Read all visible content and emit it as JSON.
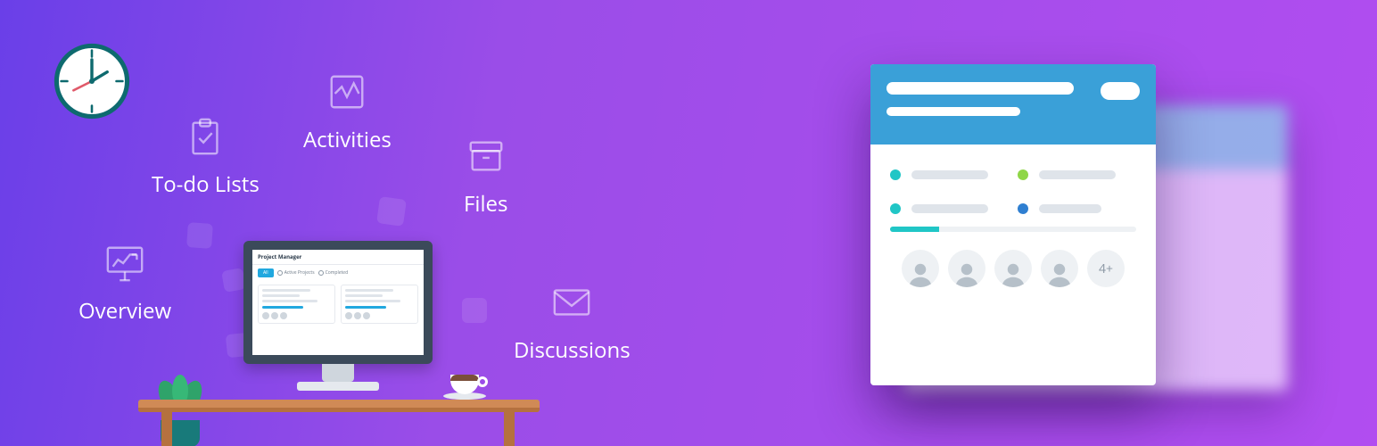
{
  "features": {
    "overview": {
      "label": "Overview"
    },
    "todo": {
      "label": "To-do Lists"
    },
    "activities": {
      "label": "Activities"
    },
    "files": {
      "label": "Files"
    },
    "discussions": {
      "label": "Discussions"
    }
  },
  "monitor_screen": {
    "app_title": "Project Manager",
    "primary_chip": "All",
    "tabs": {
      "active": "Active Projects",
      "completed": "Completed"
    }
  },
  "project_card": {
    "avatars_more_label": "4+",
    "progress_percent": 20,
    "dot_colors": {
      "a": "#20c6c6",
      "b": "#8fd647",
      "c": "#20c6c6",
      "d": "#2f7fd1"
    }
  },
  "colors": {
    "brand_blue": "#3aa0d8",
    "accent_teal": "#20c6c6"
  }
}
